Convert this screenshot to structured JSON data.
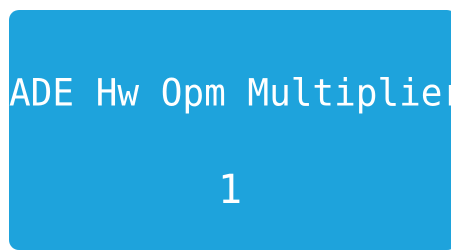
{
  "tile": {
    "title": "ADE Hw Opm Multiplier",
    "value": "1",
    "background_color": "#1ea3dc",
    "text_color": "#ffffff"
  }
}
